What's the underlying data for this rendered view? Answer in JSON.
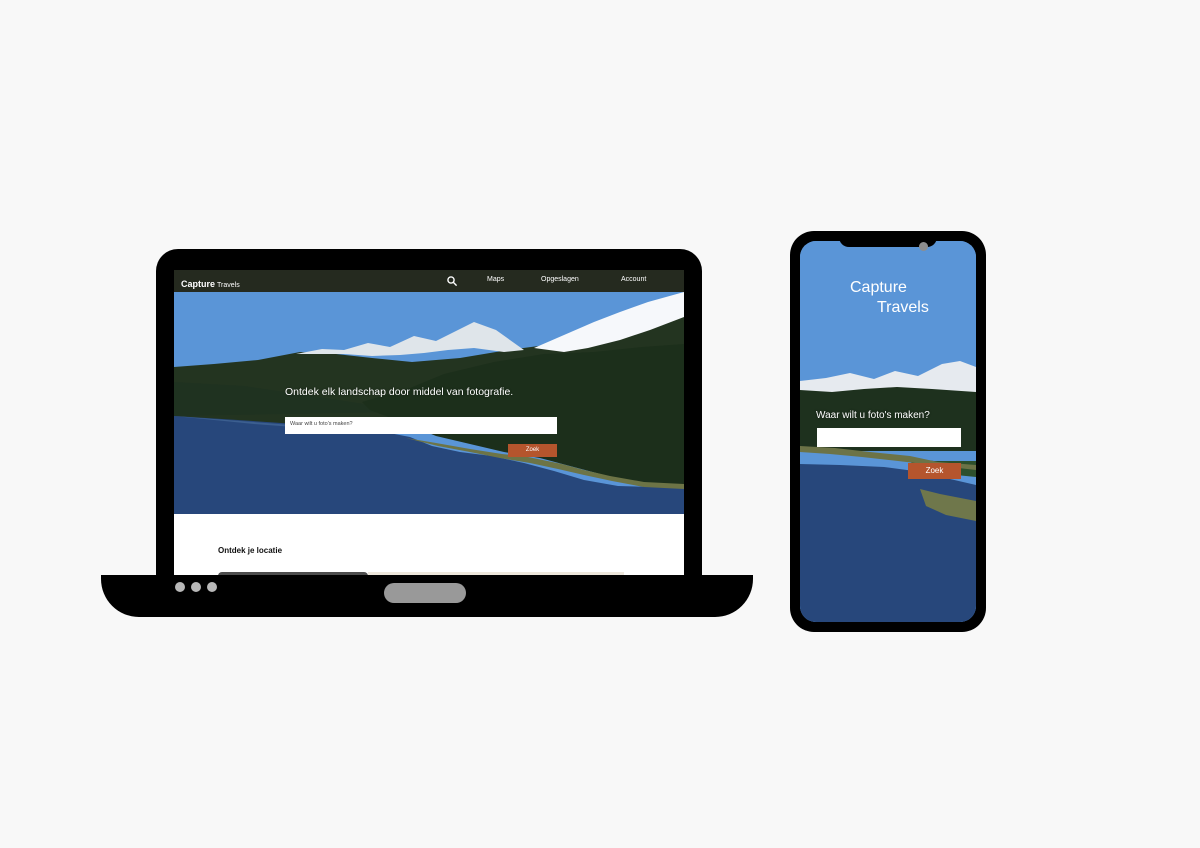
{
  "laptop": {
    "nav": {
      "logo": "Capture",
      "logo_sub": "Travels",
      "items": [
        "Maps",
        "Opgeslagen",
        "Account"
      ]
    },
    "hero": {
      "headline": "Ontdek elk landschap door middel van fotografie.",
      "search_placeholder": "Waar wilt u foto's maken?",
      "button": "Zoek"
    },
    "section": {
      "title": "Ontdek je locatie"
    }
  },
  "phone": {
    "logo_1": "Capture",
    "logo_2": "Travels",
    "label": "Waar wilt u foto's maken?",
    "button": "Zoek"
  },
  "colors": {
    "nav": "#252a1f",
    "accent": "#b5552d",
    "sky": "#5b90d4",
    "lake": "#27477b"
  },
  "icons": {
    "search": "search-icon"
  }
}
